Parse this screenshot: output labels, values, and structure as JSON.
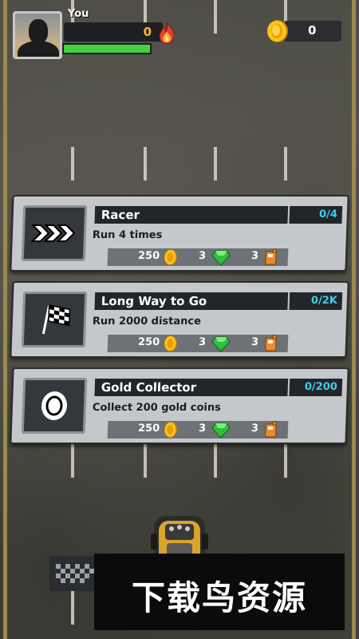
{
  "hud": {
    "player_name": "You",
    "score": "0",
    "coins": "0",
    "health_fraction": 1.0
  },
  "missions": [
    {
      "title": "Racer",
      "progress": "0/4",
      "description": "Run 4 times",
      "icon": "chevrons-icon",
      "reward_coins": "250",
      "reward_gems": "3",
      "reward_fuel": "3"
    },
    {
      "title": "Long Way to Go",
      "progress": "0/2K",
      "description": "Run 2000 distance",
      "icon": "checkered-flag-icon",
      "reward_coins": "250",
      "reward_gems": "3",
      "reward_fuel": "3"
    },
    {
      "title": "Gold Collector",
      "progress": "0/200",
      "description": "Collect 200 gold coins",
      "icon": "gold-coin-icon",
      "reward_coins": "250",
      "reward_gems": "3",
      "reward_fuel": "3"
    }
  ],
  "watermark": "下载鸟资源",
  "colors": {
    "progress_text": "#3ed0e6",
    "score_text": "#ffb428",
    "health": "#3fd43f",
    "card_bg": "#c5c8cb"
  }
}
